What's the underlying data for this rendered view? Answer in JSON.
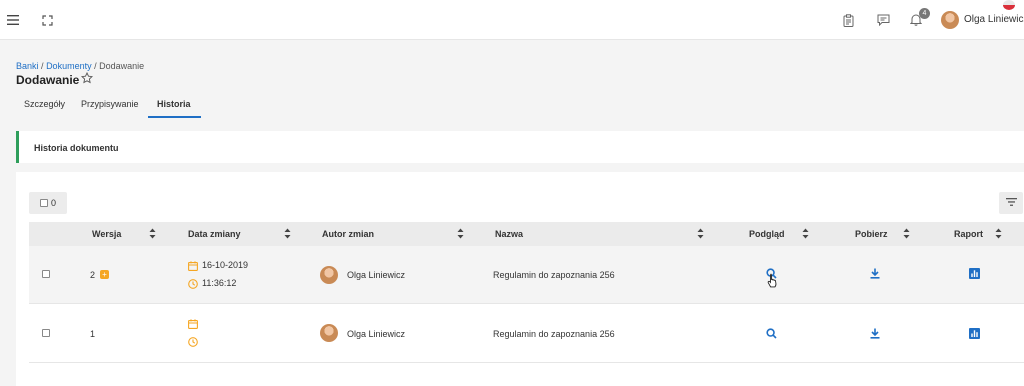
{
  "header": {
    "notification_count": "4",
    "user_name": "Olga Liniewicz"
  },
  "breadcrumb": {
    "items": [
      "Banki",
      "Dokumenty"
    ],
    "current": "Dodawanie",
    "separator": "/"
  },
  "page_title": "Dodawanie",
  "tabs": [
    {
      "label": "Szczegóły",
      "active": false
    },
    {
      "label": "Przypisywanie",
      "active": false
    },
    {
      "label": "Historia",
      "active": true
    }
  ],
  "section_title": "Historia dokumentu",
  "table": {
    "selected_count": "0",
    "columns": [
      "Wersja",
      "Data zmiany",
      "Autor zmian",
      "Nazwa",
      "Podgląd",
      "Pobierz",
      "Raport"
    ],
    "rows": [
      {
        "version": "2",
        "version_badge": "+",
        "date": "16-10-2019",
        "time": "11:36:12",
        "author": "Olga Liniewicz",
        "name": "Regulamin do zapoznania 256"
      },
      {
        "version": "1",
        "version_badge": "",
        "date": "",
        "time": "",
        "author": "Olga Liniewicz",
        "name": "Regulamin do zapoznania 256"
      }
    ]
  },
  "colors": {
    "accent": "#1f6fc5",
    "section_border": "#2e9e5b",
    "date_icon": "#f5a623"
  },
  "icons": {
    "menu": "hamburger-icon",
    "fullscreen": "fullscreen-icon",
    "clipboard": "clipboard-icon",
    "chat": "chat-icon",
    "bell": "bell-icon",
    "star": "star-icon",
    "filter": "filter-icon",
    "sort": "sort-icon",
    "calendar": "calendar-icon",
    "clock": "clock-icon",
    "preview": "search-icon",
    "download": "download-icon",
    "report": "chart-icon"
  }
}
